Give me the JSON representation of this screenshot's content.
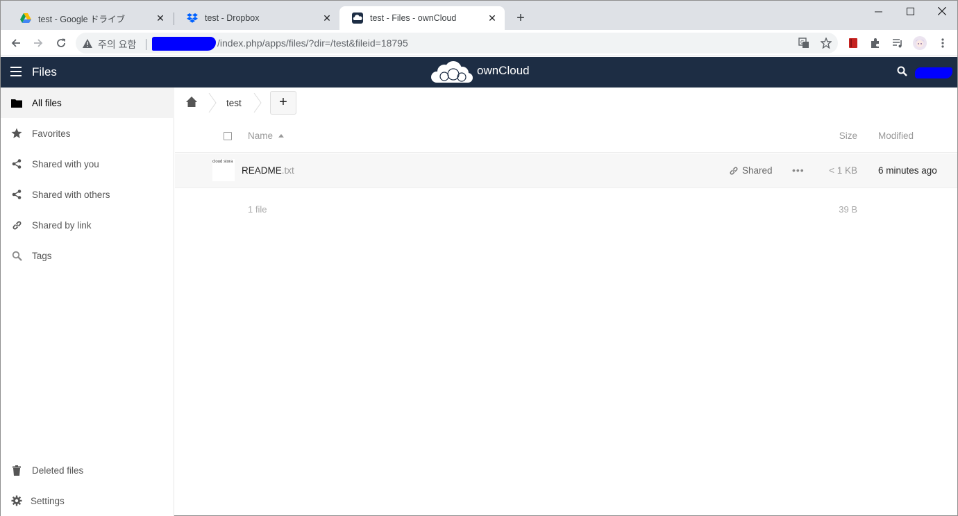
{
  "browser": {
    "tabs": [
      {
        "title": "test - Google ドライブ",
        "icon": "google-drive-icon"
      },
      {
        "title": "test - Dropbox",
        "icon": "dropbox-icon"
      },
      {
        "title": "test - Files - ownCloud",
        "icon": "owncloud-icon",
        "active": true
      }
    ],
    "security_label": "주의 요함",
    "url": "/index.php/apps/files/?dir=/test&fileid=18795"
  },
  "header": {
    "app_title": "Files",
    "brand": "ownCloud",
    "colors": {
      "bar": "#1d2d44",
      "redaction": "#0000ff"
    }
  },
  "sidebar": {
    "items": [
      {
        "label": "All files",
        "icon": "folder-icon",
        "active": true
      },
      {
        "label": "Favorites",
        "icon": "star-icon"
      },
      {
        "label": "Shared with you",
        "icon": "share-icon"
      },
      {
        "label": "Shared with others",
        "icon": "share-icon"
      },
      {
        "label": "Shared by link",
        "icon": "link-icon"
      },
      {
        "label": "Tags",
        "icon": "tag-search-icon"
      }
    ],
    "bottom": [
      {
        "label": "Deleted files",
        "icon": "trash-icon"
      },
      {
        "label": "Settings",
        "icon": "gear-icon"
      }
    ]
  },
  "breadcrumb": {
    "items": [
      "test"
    ],
    "add_label": "+"
  },
  "table": {
    "headers": {
      "name": "Name",
      "size": "Size",
      "modified": "Modified"
    },
    "rows": [
      {
        "thumb_text": "cloud stora",
        "basename": "README",
        "ext": ".txt",
        "shared_label": "Shared",
        "more_label": "•••",
        "size": "< 1 KB",
        "modified": "6 minutes ago"
      }
    ],
    "summary": {
      "count": "1 file",
      "size": "39 B"
    }
  }
}
